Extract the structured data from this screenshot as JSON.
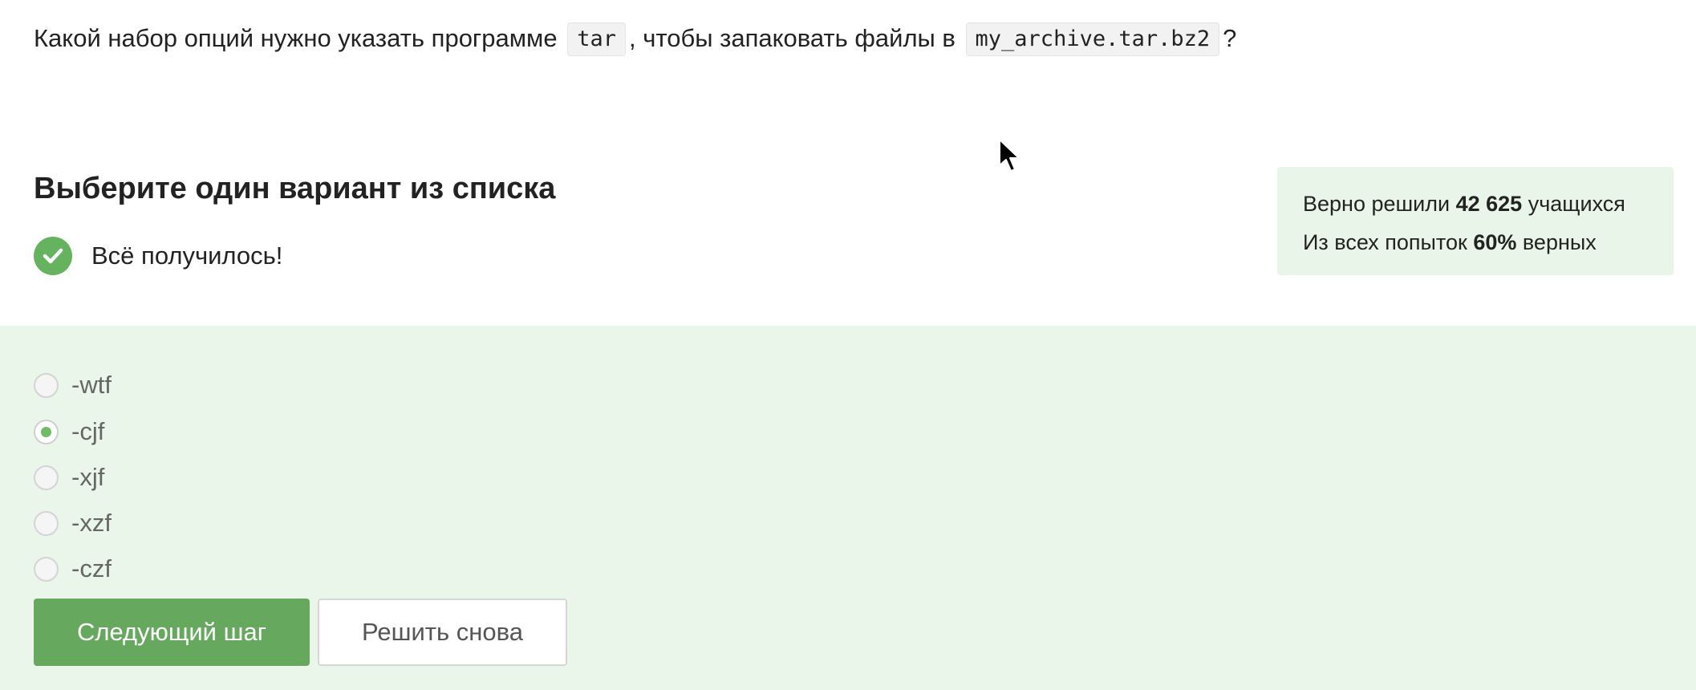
{
  "question": {
    "prefix": "Какой набор опций нужно указать программе",
    "code1": "tar",
    "middle": ", чтобы запаковать файлы в",
    "code2": "my_archive.tar.bz2",
    "suffix": "?"
  },
  "heading": "Выберите один вариант из списка",
  "result": {
    "text": "Всё получилось!",
    "icon": "checkmark-circle-icon",
    "color": "#66b35f"
  },
  "stats": {
    "line1_prefix": "Верно решили",
    "solved_count": "42 625",
    "line1_suffix": "учащихся",
    "line2_prefix": "Из всех попыток",
    "percent": "60%",
    "line2_suffix": "верных"
  },
  "options": [
    {
      "label": "-wtf",
      "selected": false
    },
    {
      "label": "-cjf",
      "selected": true
    },
    {
      "label": "-xjf",
      "selected": false
    },
    {
      "label": "-xzf",
      "selected": false
    },
    {
      "label": "-czf",
      "selected": false
    }
  ],
  "buttons": {
    "next_label": "Следующий шаг",
    "retry_label": "Решить снова"
  },
  "colors": {
    "accent": "#66a95e",
    "panel_bg": "#ebf6eb",
    "stats_bg": "#e9f5e9"
  }
}
